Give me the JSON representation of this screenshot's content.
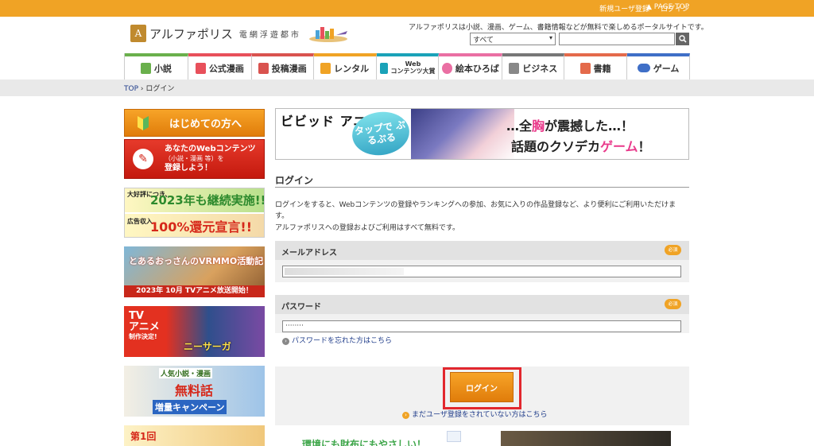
{
  "topbar": {
    "register": "新規ユーザ登録",
    "login": "ログイン",
    "page_top": "▲ PAGE TOP"
  },
  "header": {
    "logo_name": "アルファポリス",
    "logo_sub": "電網浮遊都市",
    "tagline": "アルファポリスは小説、漫画、ゲーム、書籍情報などが無料で楽しめるポータルサイトです。",
    "search_select": "すべて",
    "search_placeholder": ""
  },
  "nav": [
    {
      "label": "小説",
      "color": "#6ab04c"
    },
    {
      "label": "公式漫画",
      "color": "#e8505b"
    },
    {
      "label": "投稿漫画",
      "color": "#d9534f"
    },
    {
      "label": "レンタル",
      "color": "#f0a325"
    },
    {
      "label": "Web\nコンテンツ大賞",
      "color": "#1aa2b8"
    },
    {
      "label": "絵本ひろば",
      "color": "#ea6fa3"
    },
    {
      "label": "ビジネス",
      "color": "#777777"
    },
    {
      "label": "書籍",
      "color": "#e46a4b"
    },
    {
      "label": "ゲーム",
      "color": "#3f6fc7"
    }
  ],
  "breadcrumb": {
    "top": "TOP",
    "sep": " › ",
    "current": "ログイン"
  },
  "sidebar": {
    "beginner": "はじめての方へ",
    "register_line1": "あなたのWebコンテンツ",
    "register_line2": "（小説・漫画 等）を",
    "register_line3": "登録しよう！",
    "campaign_tag1": "大好評につき、",
    "campaign_big1": "2023年も継続実施!!",
    "campaign_tag2": "広告収入",
    "campaign_big2": "100%還元宣言!!",
    "anime1_title": "とあるおっさんのVRMMO活動記",
    "anime1_footer": "2023年 10月 TVアニメ放送開始！",
    "anime2_tv": "TV",
    "anime2_anime": "アニメ",
    "anime2_sub": "制作決定!",
    "anime2_title": "ニーサーガ",
    "free_line1": "人気小説・漫画",
    "free_line2": "無料話",
    "free_line3": "増量キャンペーン",
    "first": "第1回"
  },
  "ad": {
    "brand": "ビビッド アニミー",
    "bubble": "タップで ぷるぷる",
    "headline_pre": "…全",
    "headline_pink": "胸",
    "headline_post": "が震撼した…！",
    "headline2_pre": "話題のクソデカ",
    "headline2_pink": "ゲーム",
    "headline2_post": "！"
  },
  "login": {
    "title": "ログイン",
    "desc1": "ログインをすると、Webコンテンツの登録やランキングへの参加、お気に入りの作品登録など、より便利にご利用いただけます。",
    "desc2": "アルファポリスへの登録およびご利用はすべて無料です。",
    "email_label": "メールアドレス",
    "password_label": "パスワード",
    "required": "必須",
    "password_value": "········",
    "forgot": "パスワードを忘れた方はこちら",
    "submit": "ログイン",
    "register_link": "まだユーザ登録をされていない方はこちら"
  },
  "bottom_ad": {
    "text": "環境にも財布にもやさしい！"
  }
}
